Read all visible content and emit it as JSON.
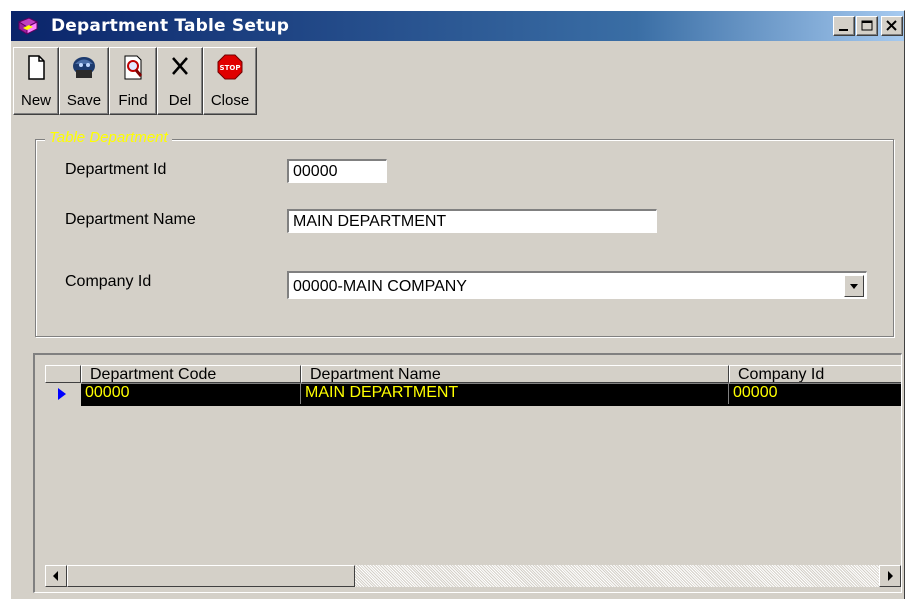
{
  "window": {
    "title": "Department Table Setup"
  },
  "toolbar": {
    "new_label": "New",
    "save_label": "Save",
    "find_label": "Find",
    "del_label": "Del",
    "close_label": "Close"
  },
  "form": {
    "group_title": "Table Department",
    "department_id_label": "Department Id",
    "department_id_value": "00000",
    "department_name_label": "Department  Name",
    "department_name_value": "MAIN DEPARTMENT",
    "company_id_label": "Company Id",
    "company_id_value": "00000-MAIN COMPANY"
  },
  "grid": {
    "columns": [
      "Department Code",
      "Department Name",
      "Company Id"
    ],
    "rows": [
      [
        "00000",
        "MAIN DEPARTMENT",
        "00000"
      ]
    ]
  },
  "icons": {
    "app": "book-icon",
    "new": "new-document-icon",
    "save": "save-icon",
    "find": "find-icon",
    "del": "delete-x-icon",
    "close": "stop-sign-icon"
  },
  "colors": {
    "window_bg": "#d4d0c8",
    "title_bar": "#0a246a",
    "group_title": "#ffff00",
    "grid_selected_bg": "#000000",
    "grid_selected_text": "#ffff00",
    "row_indicator": "#0000ff"
  }
}
